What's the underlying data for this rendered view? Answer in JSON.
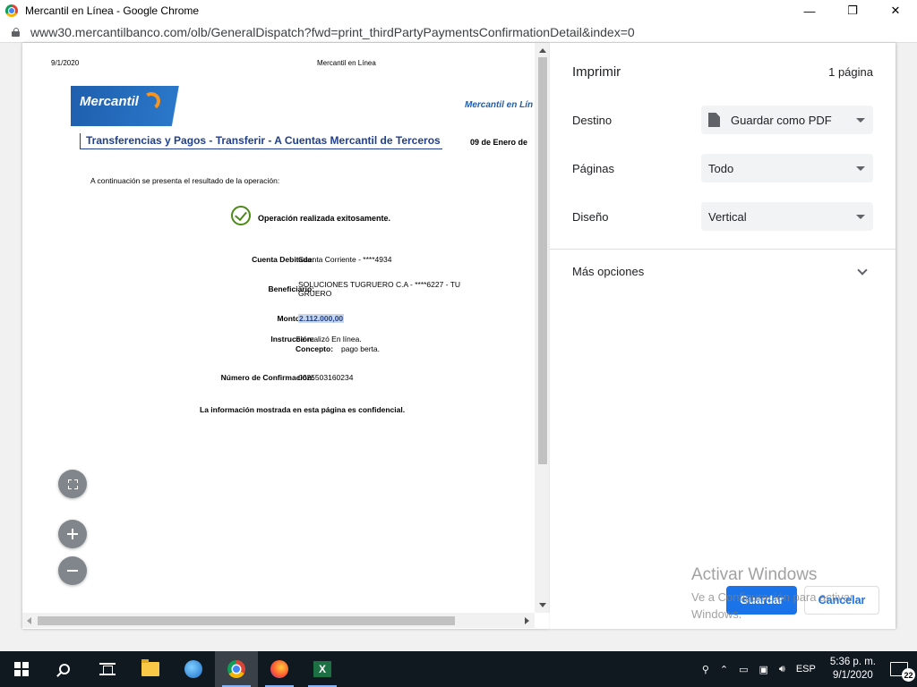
{
  "window": {
    "title": "Mercantil en Línea - Google Chrome",
    "minimize": "—",
    "maximize": "❐",
    "close": "✕"
  },
  "address_bar": {
    "url": "www30.mercantilbanco.com/olb/GeneralDispatch?fwd=print_thirdPartyPaymentsConfirmationDetail&index=0"
  },
  "preview": {
    "header_date": "9/1/2020",
    "header_title": "Mercantil en Línea",
    "logo_text": "Mercantil",
    "logo_right": "Mercantil en Lín",
    "page_title": "Transferencias y Pagos - Transferir - A Cuentas Mercantil de Terceros",
    "page_date": "09 de Enero de",
    "intro": "A continuación se presenta el resultado de la operación:",
    "success": "Operación realizada exitosamente.",
    "fields": [
      {
        "label": "Cuenta Debitada:",
        "value": "Cuenta Corriente - ****4934"
      },
      {
        "label": "Beneficiario:",
        "value": "SOLUCIONES TUGRUERO C.A - ****6227 - TU",
        "value2": "GRUERO"
      },
      {
        "label": "Monto Bs:",
        "value": "2.112.000,00"
      },
      {
        "label": "Instrucción:",
        "value": "Se realizó En línea."
      },
      {
        "label": "Concepto:",
        "value": "pago berta."
      },
      {
        "label": "Número de Confirmación:",
        "value": "0025503160234"
      }
    ],
    "confidential": "La información mostrada en esta página es confidencial."
  },
  "print_settings": {
    "title": "Imprimir",
    "page_count": "1 página",
    "destination_label": "Destino",
    "destination_value": "Guardar como PDF",
    "pages_label": "Páginas",
    "pages_value": "Todo",
    "layout_label": "Diseño",
    "layout_value": "Vertical",
    "more_options": "Más opciones",
    "save_button": "Guardar",
    "cancel_button": "Cancelar"
  },
  "watermark": {
    "line1": "Activar Windows",
    "line2": "Ve a Configuración para activar Windows."
  },
  "taskbar": {
    "excel_letter": "X",
    "tray_lang": "ESP",
    "clock_time": "5:36 p. m.",
    "clock_date": "9/1/2020",
    "notification_count": "22"
  }
}
